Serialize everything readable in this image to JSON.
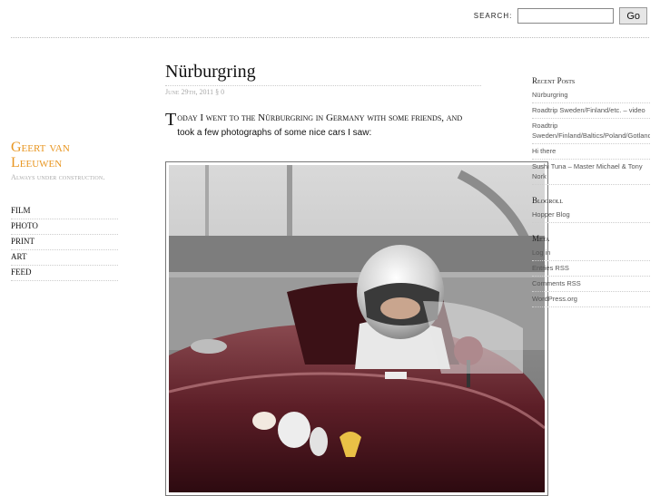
{
  "header": {
    "search_label": "SEARCH:",
    "search_value": "",
    "go_label": "Go"
  },
  "site": {
    "title": "Geert van Leeuwen",
    "tagline": "Always under construction."
  },
  "nav": {
    "items": [
      "Film",
      "Photo",
      "Print",
      "Art",
      "Feed"
    ]
  },
  "post": {
    "title": "Nürburgring",
    "meta": "June 29th, 2011 § 0",
    "body_cap": "T",
    "body_sc": "oday I went to the Nürburgring in Germany with some friends, and",
    "body_rest": "took a few photographs of some nice cars I saw:"
  },
  "sidebar": {
    "recent_heading": "Recent Posts",
    "recent": [
      "Nürburgring",
      "Roadtrip Sweden/Finland/etc. – video",
      "Roadtrip Sweden/Finland/Baltics/Poland/Gotland",
      "Hi there",
      "Sushi Tuna – Master Michael & Tony Nork"
    ],
    "blogroll_heading": "Blogroll",
    "blogroll": [
      "Hopper Blog"
    ],
    "meta_heading": "Meta",
    "meta": [
      "Log in",
      "Entries RSS",
      "Comments RSS",
      "WordPress.org"
    ]
  }
}
